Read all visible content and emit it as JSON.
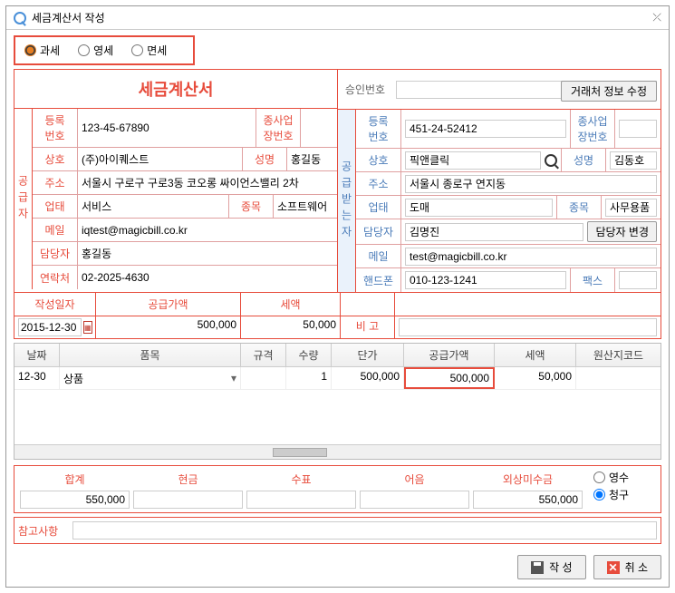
{
  "window_title": "세금계산서 작성",
  "tax_types": {
    "taxable": "과세",
    "zero": "영세",
    "exempt": "면세"
  },
  "doc_title": "세금계산서",
  "approval_label": "승인번호",
  "btn_edit_vendor": "거래처 정보 수정",
  "supplier": {
    "vert": "공급자",
    "reg_label": "등록\n번호",
    "reg": "123-45-67890",
    "sub_label": "종사업\n장번호",
    "sub": "",
    "company_label": "상호",
    "company": "(주)아이퀘스트",
    "name_label": "성명",
    "name": "홍길동",
    "addr_label": "주소",
    "addr": "서울시 구로구 구로3동 코오롱 싸이언스밸리 2차",
    "biz_label": "업태",
    "biz": "서비스",
    "item_label": "종목",
    "item": "소프트웨어",
    "email_label": "메일",
    "email": "iqtest@magicbill.co.kr",
    "contact_label": "담당자",
    "contact": "홍길동",
    "phone_label": "연락처",
    "phone": "02-2025-4630"
  },
  "receiver": {
    "vert": "공급받는자",
    "reg_label": "등록\n번호",
    "reg": "451-24-52412",
    "sub_label": "종사업\n장번호",
    "sub": "",
    "company_label": "상호",
    "company": "픽앤클릭",
    "name_label": "성명",
    "name": "김동호",
    "addr_label": "주소",
    "addr": "서울시 종로구 연지동",
    "biz_label": "업태",
    "biz": "도매",
    "item_label": "종목",
    "item": "사무용품",
    "contact_label": "담당자",
    "contact": "김명진",
    "btn_change_contact": "담당자 변경",
    "email_label": "메일",
    "email": "test@magicbill.co.kr",
    "phone_label": "핸드폰",
    "phone": "010-123-1241",
    "fax_label": "팩스",
    "fax": ""
  },
  "summary": {
    "date_label": "작성일자",
    "supply_label": "공급가액",
    "tax_label": "세액",
    "remark_label": "비 고",
    "date": "2015-12-30",
    "supply": "500,000",
    "tax": "50,000",
    "remark": ""
  },
  "grid": {
    "h_date": "날짜",
    "h_item": "품목",
    "h_spec": "규격",
    "h_qty": "수량",
    "h_price": "단가",
    "h_supply": "공급가액",
    "h_tax": "세액",
    "h_origin": "원산지코드",
    "row": {
      "date": "12-30",
      "item": "상품",
      "spec": "",
      "qty": "1",
      "price": "500,000",
      "supply": "500,000",
      "tax": "50,000",
      "origin": ""
    }
  },
  "totals": {
    "h_total": "합계",
    "h_cash": "현금",
    "h_check": "수표",
    "h_note": "어음",
    "h_credit": "외상미수금",
    "total": "550,000",
    "cash": "",
    "check": "",
    "note": "",
    "credit": "550,000",
    "r_receipt": "영수",
    "r_bill": "청구"
  },
  "ref_label": "참고사항",
  "btn_create": "작 성",
  "btn_cancel": "취 소"
}
